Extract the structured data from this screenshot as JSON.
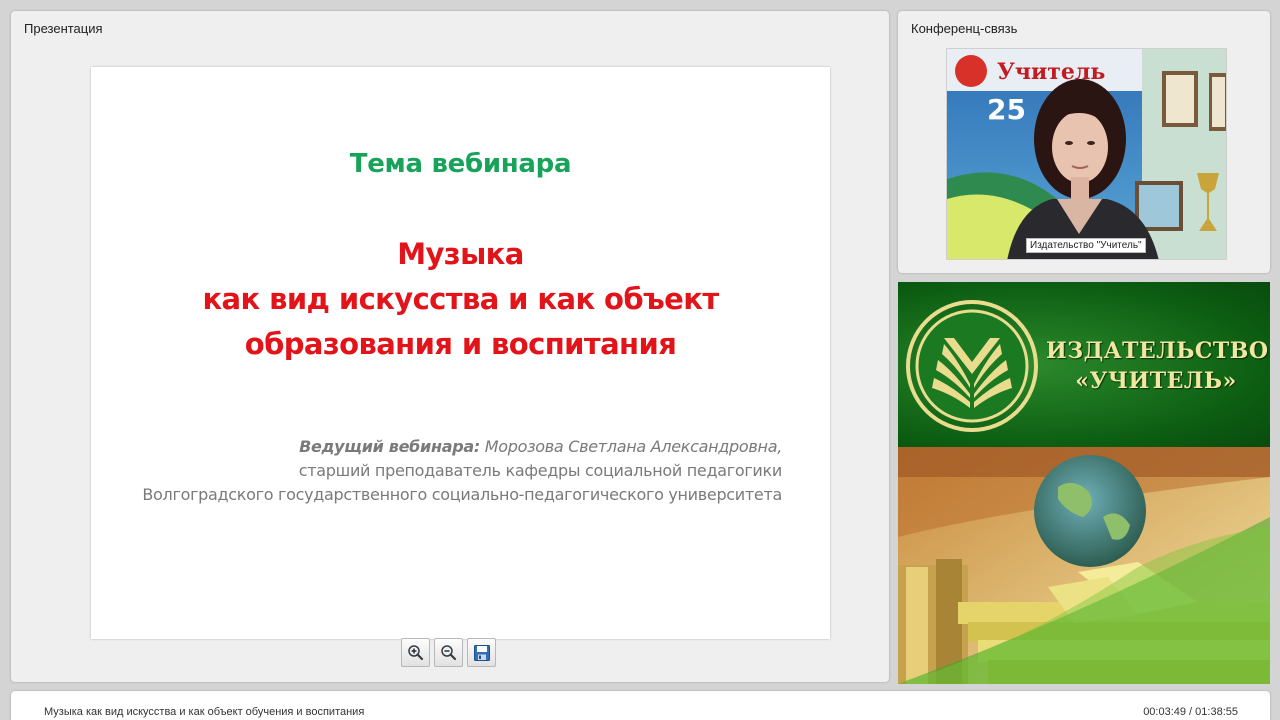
{
  "presentation": {
    "panel_title": "Презентация",
    "slide": {
      "heading": "Тема вебинара",
      "topic_lines": [
        "Музыка",
        "как вид искусства и как объект",
        "образования и воспитания"
      ],
      "presenter_label": "Ведущий вебинара:",
      "presenter_name": "Морозова Светлана Александровна,",
      "presenter_position": "старший преподаватель кафедры социальной педагогики",
      "presenter_university": "Волгоградского государственного социально-педагогического университета"
    },
    "toolbar": {
      "zoom_in_icon": "zoom-in-icon",
      "zoom_out_icon": "zoom-out-icon",
      "save_icon": "save-icon"
    }
  },
  "conference": {
    "panel_title": "Конференц-связь",
    "video_label": "Издательство \"Учитель\""
  },
  "publisher": {
    "name_line1": "ИЗДАТЕЛЬСТВО",
    "name_line2": "«УЧИТЕЛЬ»"
  },
  "footer": {
    "webinar_title": "Музыка как вид искусства и как объект обучения и воспитания",
    "time": "00:03:49 / 01:38:55"
  },
  "colors": {
    "heading_green": "#18a35a",
    "topic_red": "#e2141a",
    "banner_green": "#0c5d12",
    "banner_gold": "#f3e6a2"
  }
}
